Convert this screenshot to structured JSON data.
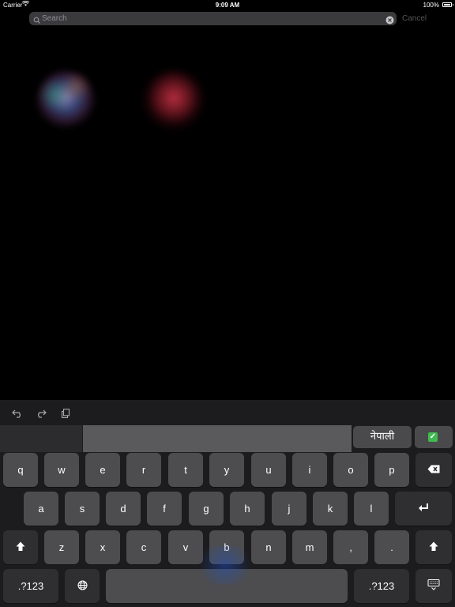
{
  "status_bar": {
    "carrier": "Carrier",
    "time": "9:09 AM",
    "battery": "100%"
  },
  "search": {
    "placeholder": "Search",
    "value": "",
    "cancel_label": "Cancel"
  },
  "candidate_bar": {
    "language": "नेपाली",
    "check_icon": "check-box-icon"
  },
  "toolbar": {
    "icons": [
      "undo-icon",
      "redo-icon",
      "paste-icon"
    ]
  },
  "keyboard": {
    "row1": [
      "q",
      "w",
      "e",
      "r",
      "t",
      "y",
      "u",
      "i",
      "o",
      "p"
    ],
    "row2": [
      "a",
      "s",
      "d",
      "f",
      "g",
      "h",
      "j",
      "k",
      "l"
    ],
    "row3": [
      "z",
      "x",
      "c",
      "v",
      "b",
      "n",
      "m",
      ",",
      "."
    ],
    "numbers_left": ".?123",
    "numbers_right": ".?123",
    "icons": [
      "backspace-icon",
      "return-icon",
      "shift-icon",
      "globe-icon",
      "dismiss-keyboard-icon"
    ]
  }
}
